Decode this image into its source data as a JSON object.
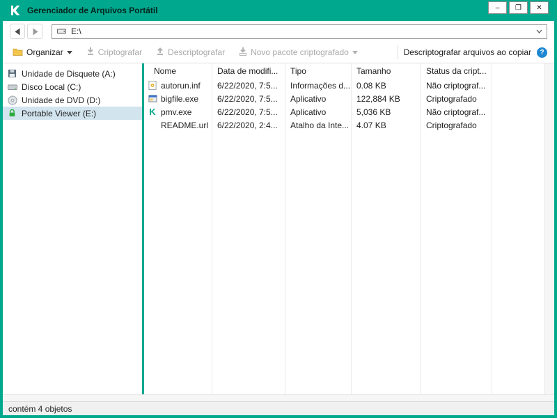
{
  "colors": {
    "accent": "#00a88e",
    "help": "#1e87d4",
    "lock": "#2fab3f",
    "selection": "#d2e4ee"
  },
  "window": {
    "title": "Gerenciador de Arquivos Portátil",
    "controls": {
      "minimize": "–",
      "maximize": "❐",
      "close": "✕"
    }
  },
  "navbar": {
    "address": "E:\\"
  },
  "toolbar": {
    "organize": "Organizar",
    "encrypt": "Criptografar",
    "decrypt": "Descriptografar",
    "new_package": "Novo pacote criptografado",
    "decrypt_on_copy": "Descriptografar arquivos ao copiar",
    "help_glyph": "?"
  },
  "sidebar": {
    "items": [
      {
        "label": "Unidade de Disquete (A:)",
        "icon": "floppy-drive-icon",
        "selected": false
      },
      {
        "label": "Disco Local (C:)",
        "icon": "hard-disk-icon",
        "selected": false
      },
      {
        "label": "Unidade de DVD (D:)",
        "icon": "dvd-drive-icon",
        "selected": false
      },
      {
        "label": "Portable Viewer (E:)",
        "icon": "lock-icon",
        "selected": true
      }
    ]
  },
  "filelist": {
    "columns": [
      "Nome",
      "Data de modifi...",
      "Tipo",
      "Tamanho",
      "Status da cript..."
    ],
    "rows": [
      {
        "icon": "inf-file-icon",
        "name": "autorun.inf",
        "date": "6/22/2020, 7:5...",
        "type": "Informações d...",
        "size": "0.08 KB",
        "status": "Não criptograf..."
      },
      {
        "icon": "exe-file-icon",
        "name": "bigfile.exe",
        "date": "6/22/2020, 7:5...",
        "type": "Aplicativo",
        "size": "122,884 KB",
        "status": "Criptografado"
      },
      {
        "icon": "kaspersky-app-icon",
        "name": "pmv.exe",
        "date": "6/22/2020, 7:5...",
        "type": "Aplicativo",
        "size": "5,036 KB",
        "status": "Não criptograf..."
      },
      {
        "icon": "url-file-icon",
        "name": "README.url",
        "date": "6/22/2020, 2:4...",
        "type": "Atalho da Inte...",
        "size": "4.07 KB",
        "status": "Criptografado"
      }
    ]
  },
  "statusbar": {
    "text": "contém 4 objetos"
  }
}
